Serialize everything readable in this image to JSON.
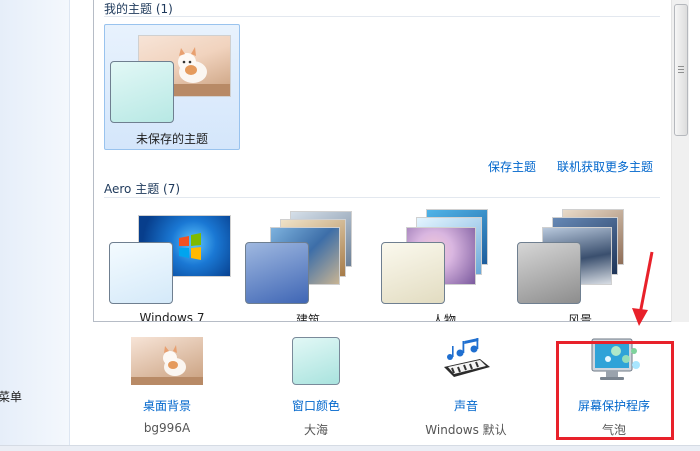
{
  "nav": {
    "partial_link": "菜单"
  },
  "my_themes": {
    "heading": "我的主题 (1)",
    "items": [
      {
        "label": "未保存的主题",
        "selected": true
      }
    ],
    "save_link": "保存主题",
    "online_link": "联机获取更多主题"
  },
  "aero_themes": {
    "heading": "Aero 主题 (7)",
    "items": [
      {
        "label": "Windows 7"
      },
      {
        "label": "建筑"
      },
      {
        "label": "人物"
      },
      {
        "label": "风景"
      }
    ]
  },
  "settings": {
    "desktop_background": {
      "label": "桌面背景",
      "value": "bg996A"
    },
    "window_color": {
      "label": "窗口颜色",
      "value": "大海"
    },
    "sounds": {
      "label": "声音",
      "value": "Windows 默认"
    },
    "screen_saver": {
      "label": "屏幕保护程序",
      "value": "气泡"
    }
  },
  "colors": {
    "link": "#0066cc",
    "highlight": "#e8212a",
    "selection": "#d4e6fb"
  }
}
